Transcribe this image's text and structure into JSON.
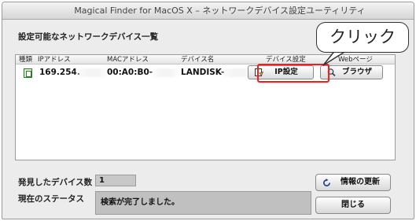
{
  "window": {
    "title": "Magical Finder for MacOS X – ネットワークデバイス設定ユーティリティ"
  },
  "section_label": "設定可能なネットワークデバイス一覧",
  "table": {
    "columns": [
      "種類",
      "IPアドレス",
      "MACアドレス",
      "デバイス名",
      "デバイス設定",
      "Webページ"
    ],
    "row": {
      "ip": "169.254.",
      "mac": "00:A0:B0-",
      "device_name": "LANDISK-",
      "ellipsis": "..",
      "ip_settings_label": "IP設定",
      "browser_label": "ブラウザ"
    }
  },
  "callout": {
    "text": "クリック",
    "color": "#ff1a1a"
  },
  "footer": {
    "found_devices_label": "発見したデバイス数",
    "found_devices_count": "1",
    "status_label": "現在のステータス",
    "status_text": "検索が完了しました。",
    "refresh_label": "情報の更新",
    "close_label": "閉じる"
  }
}
